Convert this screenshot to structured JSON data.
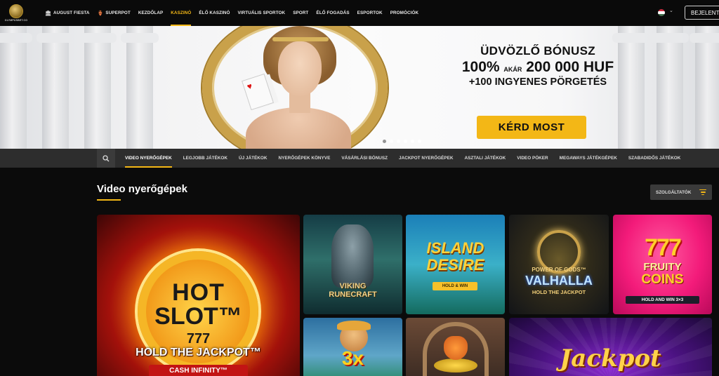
{
  "header": {
    "logo_text": "OLYMPUSBET.CO",
    "nav": [
      {
        "label": "AUGUST FIESTA",
        "icon": "party-icon"
      },
      {
        "label": "SUPERPOT",
        "icon": "pot-icon"
      },
      {
        "label": "KEZDŐLAP"
      },
      {
        "label": "KASZINÓ",
        "active": true
      },
      {
        "label": "ÉLŐ KASZINÓ"
      },
      {
        "label": "VIRTUÁLIS SPORTOK"
      },
      {
        "label": "SPORT"
      },
      {
        "label": "ÉLŐ FOGADÁS"
      },
      {
        "label": "ESPORTOK"
      },
      {
        "label": "PROMÓCIÓK"
      }
    ],
    "language_flag": "hungary-flag-icon",
    "login_label": "BEJELENTKEZÉS"
  },
  "hero": {
    "line1": "ÜDVÖZLŐ BÓNUSZ",
    "line2_prefix": "100%",
    "line2_small": "AKÁR",
    "line2_amount": "200 000 HUF",
    "line3": "+100 INGYENES PÖRGETÉS",
    "cta_label": "KÉRD MOST",
    "slides_count": 6,
    "active_slide": 0
  },
  "subnav": {
    "items": [
      {
        "label": "VIDEO NYERŐGÉPEK",
        "active": true
      },
      {
        "label": "LEGJOBB JÁTÉKOK"
      },
      {
        "label": "ÚJ JÁTÉKOK"
      },
      {
        "label": "NYERŐGÉPEK KÖNYVE"
      },
      {
        "label": "VÁSÁRLÁSI BÓNUSZ"
      },
      {
        "label": "JACKPOT NYERŐGÉPEK"
      },
      {
        "label": "ASZTALI JÁTÉKOK"
      },
      {
        "label": "VIDEO PÓKER"
      },
      {
        "label": "MEGAWAYS JÁTÉKGÉPEK"
      },
      {
        "label": "SZABADIDŐS JÁTÉKOK"
      }
    ]
  },
  "main": {
    "section_title": "Video nyerőgépek",
    "providers_label": "SZOLGÁLTATÓK",
    "games": {
      "hot_slot": {
        "l1": "HOT",
        "l2": "SLOT™",
        "l3": "777",
        "l4": "HOLD THE JACKPOT™",
        "l5": "CASH INFINITY™"
      },
      "viking": {
        "l1": "VIKING",
        "l2": "RUNECRAFT"
      },
      "island": {
        "l1": "ISLAND",
        "l2": "DESIRE",
        "badge": "HOLD & WIN"
      },
      "valhalla": {
        "l1": "POWER OF GODS™",
        "l2": "VALHALLA",
        "l3": "HOLD THE JACKPOT"
      },
      "fruity": {
        "sev": "777",
        "l1": "FRUITY",
        "l2": "COINS",
        "badge": "HOLD AND WIN 3×3"
      },
      "fisher": {
        "mult": "3x"
      },
      "jackpot": {
        "l1": "Jackpot"
      }
    }
  },
  "colors": {
    "accent": "#f3b716",
    "subnav_bg": "#2d2d2d",
    "page_bg": "#0b0b0b"
  }
}
